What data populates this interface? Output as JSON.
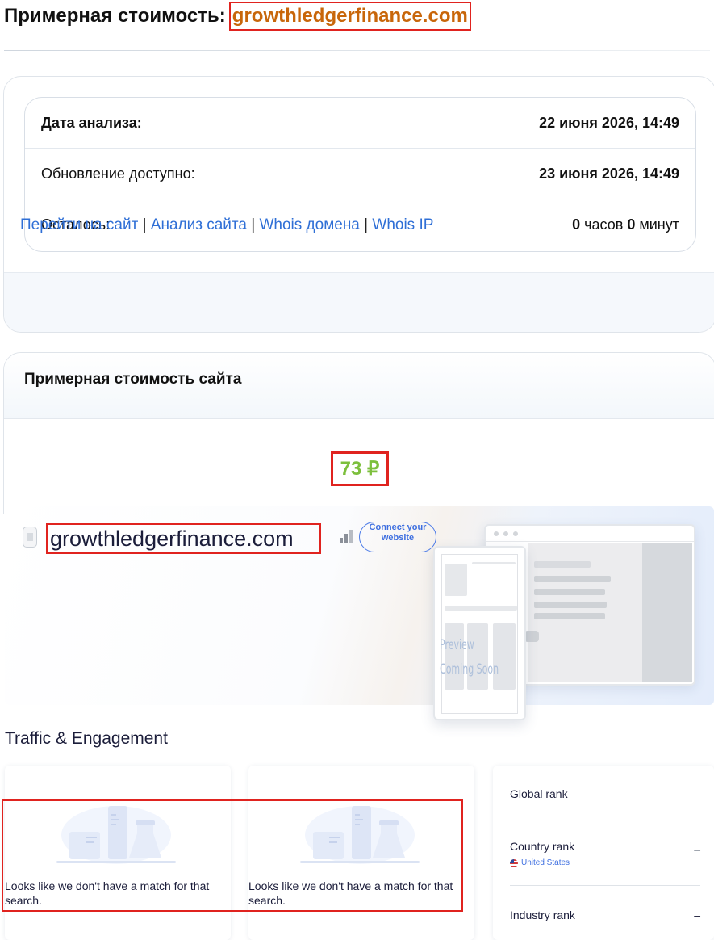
{
  "header": {
    "title": "Примерная стоимость:",
    "domain": "growthledgerfinance.com"
  },
  "info_card": {
    "rows": [
      {
        "label": "Дата анализа:",
        "value": "22 июня 2026, 14:49"
      },
      {
        "label": "Обновление доступно:",
        "value": "23 июня 2026, 14:49"
      },
      {
        "label": "Осталось:",
        "hours_value": "0",
        "hours_unit": "часов",
        "minutes_value": "0",
        "minutes_unit": "минут"
      }
    ],
    "links": [
      "Перейти на сайт",
      "Анализ сайта",
      "Whois домена",
      "Whois IP"
    ],
    "separator": "|"
  },
  "value_card": {
    "title": "Примерная стоимость сайта",
    "price": "73 ₽"
  },
  "similarweb": {
    "domain": "growthledgerfinance.com",
    "connect_label": "Connect your website",
    "preview_line1": "Preview",
    "preview_line2": "Coming Soon",
    "section_title": "Traffic & Engagement",
    "empty_message": "Looks like we don't have a match for that search.",
    "ranks": [
      {
        "label": "Global rank",
        "value": "–"
      },
      {
        "label": "Country rank",
        "sub": "United States",
        "value": "–"
      },
      {
        "label": "Industry rank",
        "value": "–"
      }
    ]
  },
  "colors": {
    "domain_text": "#c8660a",
    "highlight_border": "#e0231f",
    "price": "#7cbf3c",
    "link": "#2f6fd6",
    "accent_blue": "#3e6fe0"
  }
}
